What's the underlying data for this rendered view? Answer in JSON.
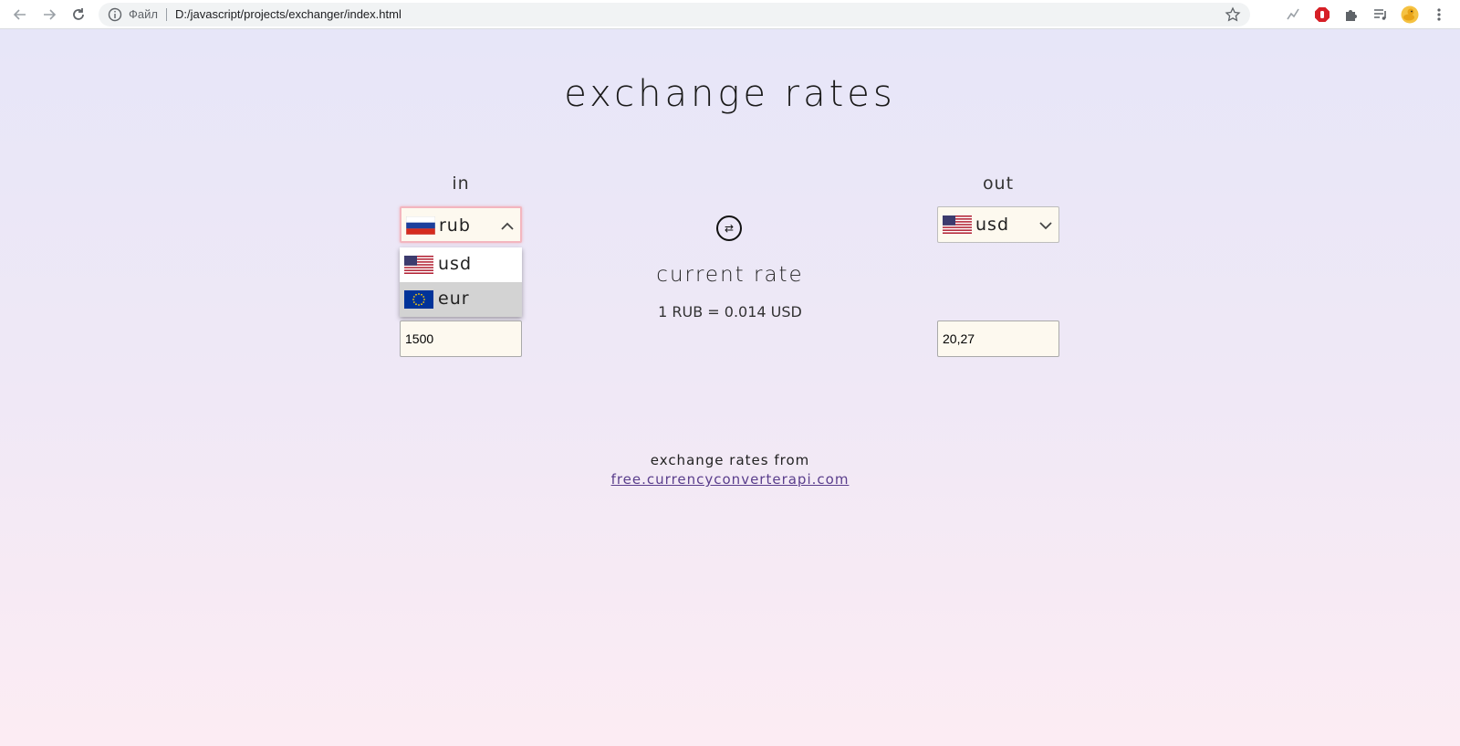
{
  "browser": {
    "scheme_label": "Файл",
    "url": "D:/javascript/projects/exchanger/index.html",
    "icons": [
      "back-icon",
      "forward-icon",
      "reload-icon",
      "info-icon",
      "star-icon",
      "extension-icon",
      "adblock-icon",
      "puzzle-icon",
      "media-icon",
      "duck-icon",
      "menu-icon"
    ]
  },
  "page": {
    "title": "exchange rates",
    "in_label": "in",
    "out_label": "out",
    "swap_symbol": "⇄",
    "current_rate_title": "current rate",
    "current_rate_value": "1 RUB = 0.014 USD",
    "footer_text": "exchange rates from",
    "footer_link": "free.currencyconverterapi.com"
  },
  "in_select": {
    "selected": "rub",
    "options": [
      {
        "label": "usd",
        "flag": "us-flag"
      },
      {
        "label": "eur",
        "flag": "eu-flag"
      }
    ]
  },
  "out_select": {
    "selected": "usd"
  },
  "in_amount": "1500",
  "out_amount": "20,27",
  "colors": {
    "input_bg": "#fdf9ef",
    "focus_border": "#f3b6bf",
    "link": "#5a3e8c",
    "hover_option": "#d3d3d3"
  }
}
